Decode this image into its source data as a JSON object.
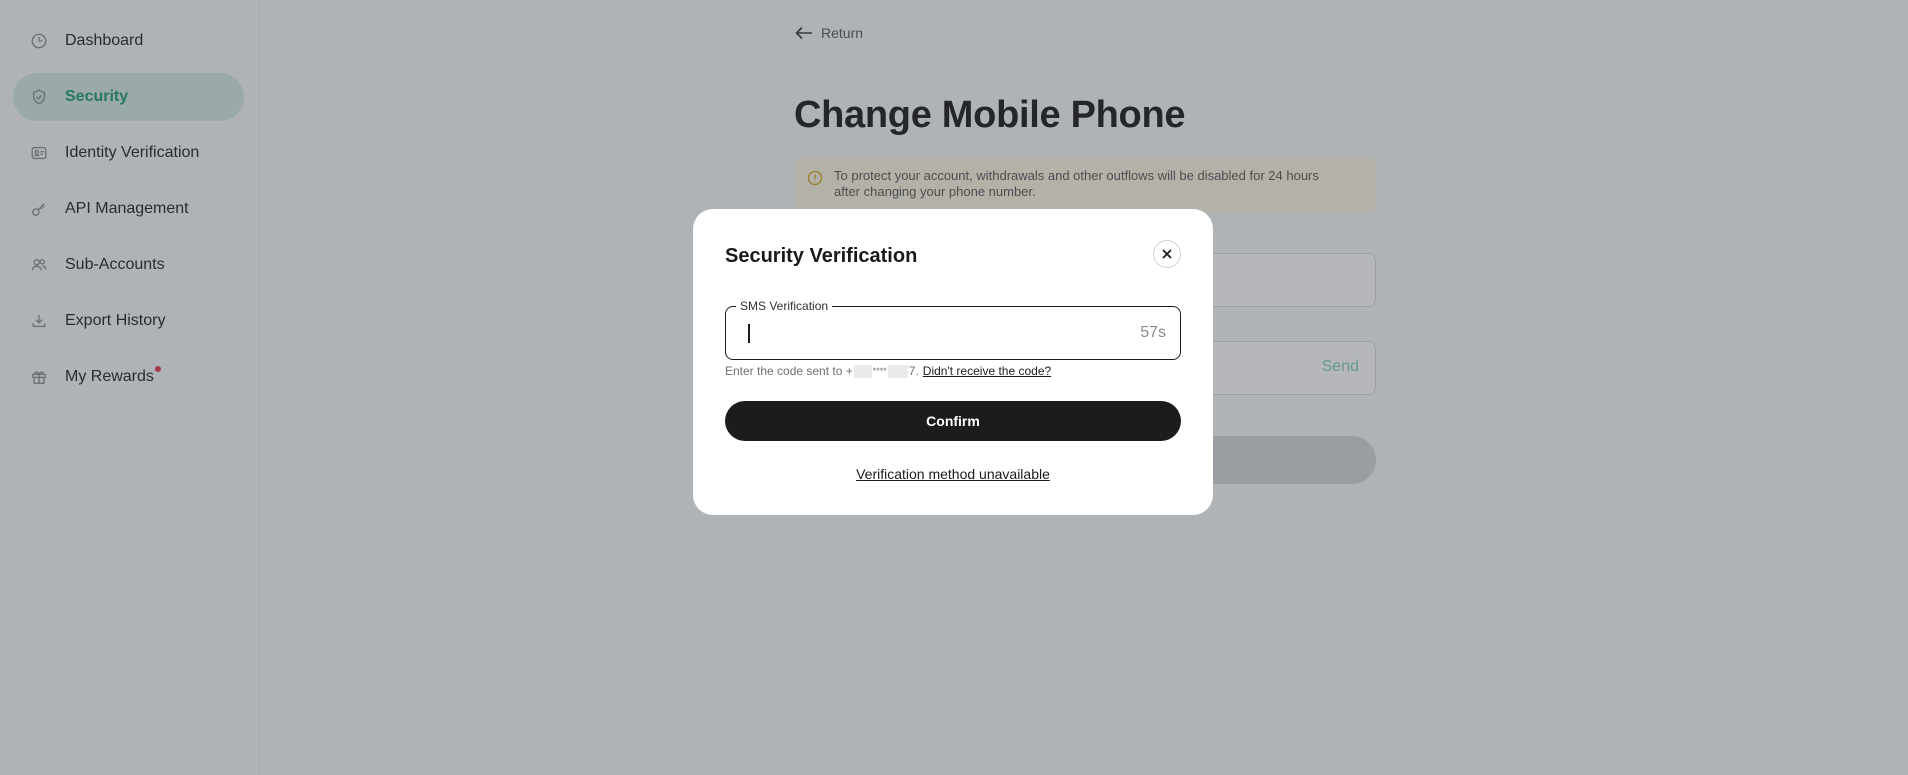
{
  "sidebar": {
    "items": [
      {
        "label": "Dashboard",
        "icon": "clock-icon"
      },
      {
        "label": "Security",
        "icon": "shield-icon",
        "active": true
      },
      {
        "label": "Identity Verification",
        "icon": "id-card-icon"
      },
      {
        "label": "API Management",
        "icon": "key-icon"
      },
      {
        "label": "Sub-Accounts",
        "icon": "users-icon"
      },
      {
        "label": "Export History",
        "icon": "download-icon"
      },
      {
        "label": "My Rewards",
        "icon": "gift-icon",
        "badge": true
      }
    ]
  },
  "main": {
    "return_label": "Return",
    "title": "Change Mobile Phone",
    "notice_line1": "To protect your account, withdrawals and other outflows will be disabled for 24 hours",
    "notice_line2": "after changing your phone number.",
    "send_label": "Send"
  },
  "modal": {
    "title": "Security Verification",
    "sms_label": "SMS Verification",
    "sms_value": "",
    "countdown": "57s",
    "hint_prefix": "Enter the code sent to +",
    "hint_masked": "****",
    "hint_suffix": "7.",
    "resend_label": "Didn't receive the code?",
    "confirm_label": "Confirm",
    "unavailable_label": "Verification method unavailable"
  },
  "colors": {
    "accent": "#1a9a6b",
    "active_bg": "#d3ebe3",
    "primary_button": "#1c1c1c",
    "badge": "#e2374c",
    "notice_bg": "#fdf6e3",
    "notice_icon": "#d4a017"
  }
}
